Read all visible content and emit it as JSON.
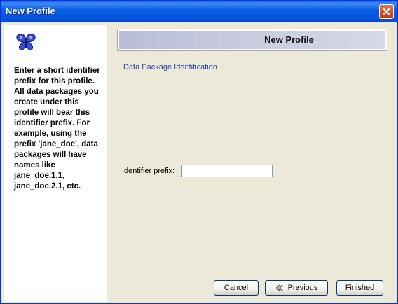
{
  "window": {
    "title": "New Profile"
  },
  "sidebar": {
    "description": "Enter a short identifier prefix for this profile. All data packages you create under this profile will bear this identifier prefix. For example, using the prefix 'jane_doe', data packages will have names like jane_doe.1.1, jane_doe.2.1, etc."
  },
  "header": {
    "title": "New Profile"
  },
  "main": {
    "section_link": "Data Package Identification",
    "identifier_label": "Identifier prefix:",
    "identifier_value": ""
  },
  "buttons": {
    "cancel": "Cancel",
    "previous": "Previous",
    "finished": "Finished"
  },
  "icons": {
    "logo": "butterfly-icon",
    "close": "close-icon",
    "previous": "double-chevron-left-icon"
  },
  "colors": {
    "titlebar": "#0a5be4",
    "link": "#2148a8",
    "close": "#c2351a"
  }
}
